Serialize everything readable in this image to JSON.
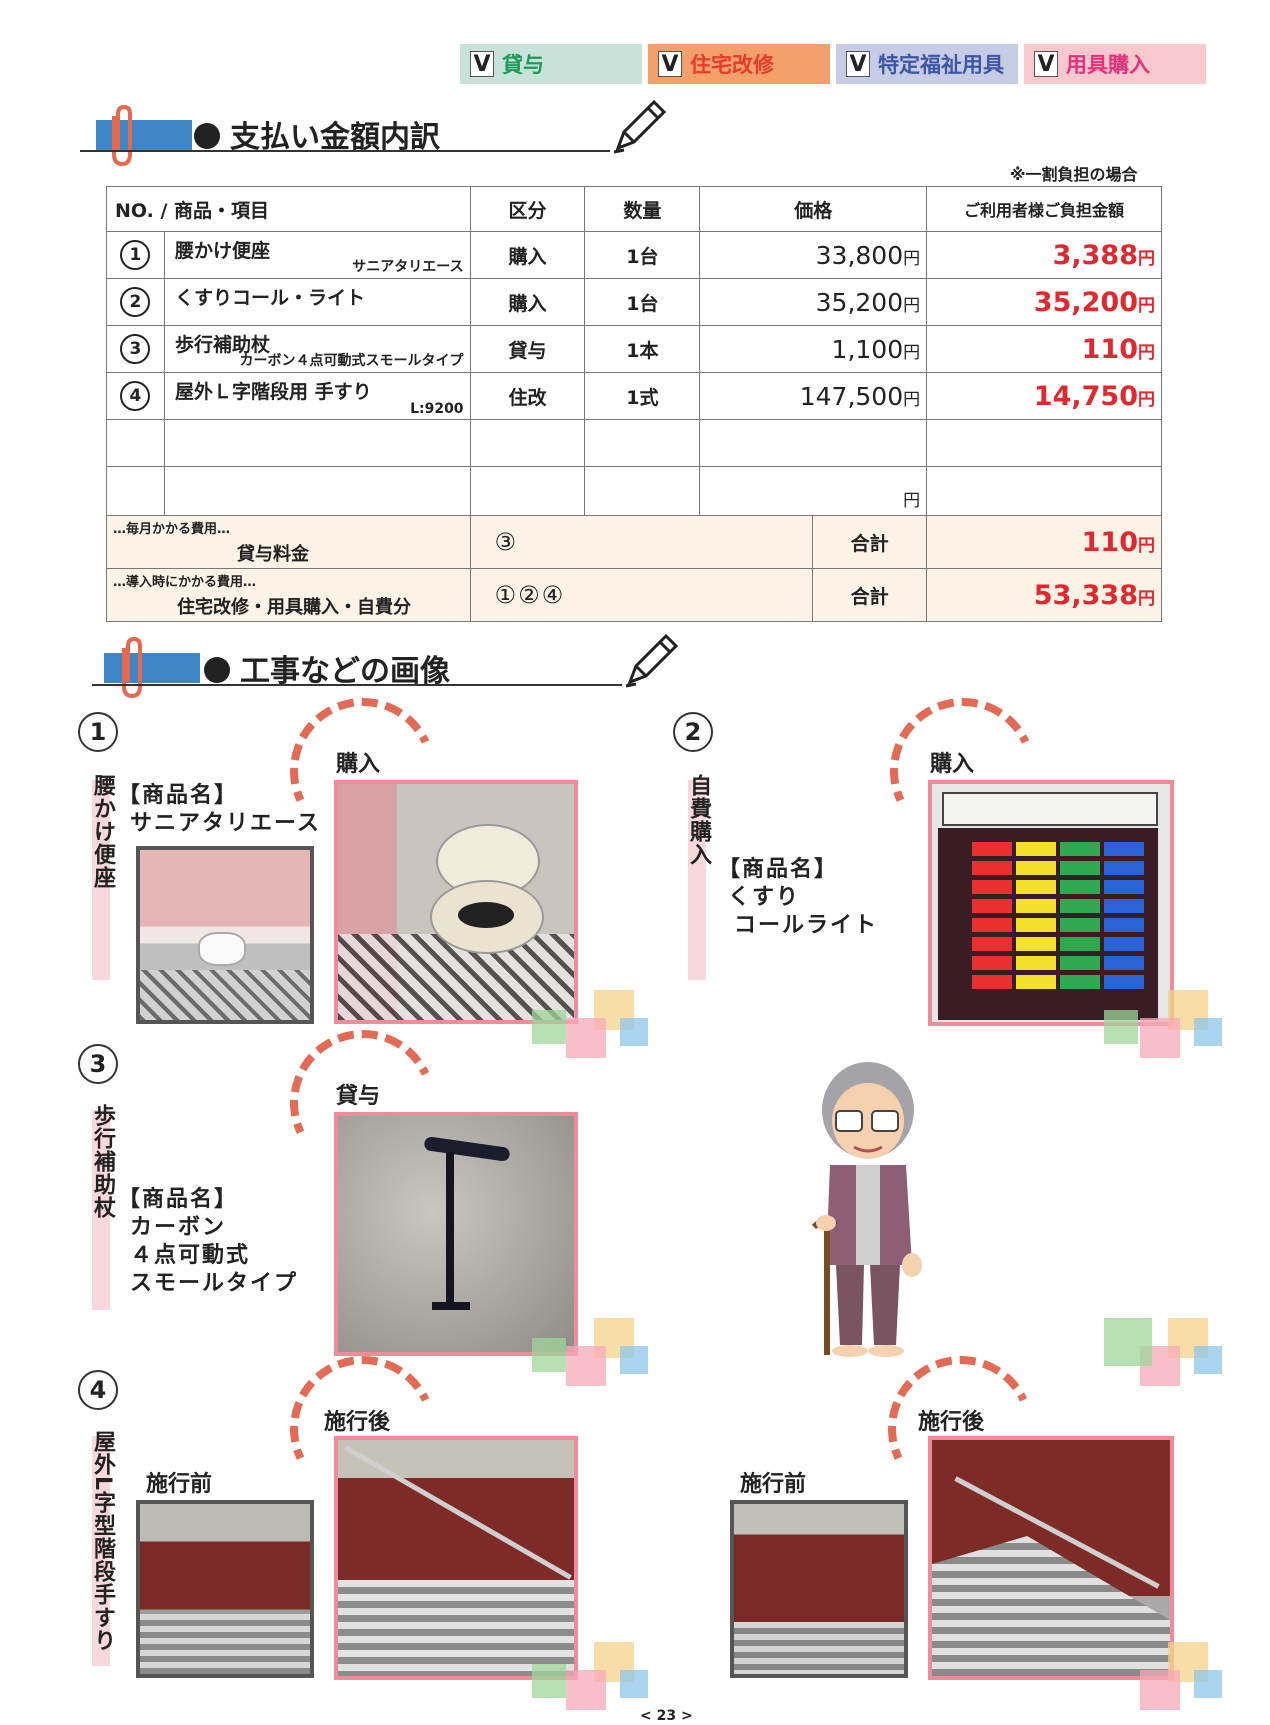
{
  "tags": [
    {
      "label": "貸与",
      "bg": "#c6e2d9",
      "fg": "#1f9a55"
    },
    {
      "label": "住宅改修",
      "bg": "#f4a06d",
      "fg": "#e83b2a"
    },
    {
      "label": "特定福祉用具",
      "bg": "#c6cbe6",
      "fg": "#3d57a3"
    },
    {
      "label": "用具購入",
      "bg": "#f9c8cd",
      "fg": "#e8307a"
    }
  ],
  "check_mark": "V",
  "section1": {
    "title": "支払い金額内訳",
    "note": "※一割負担の場合"
  },
  "table": {
    "headers": [
      "NO. / 商品・項目",
      "区分",
      "数量",
      "価格",
      "ご利用者様ご負担金額"
    ],
    "rows": [
      {
        "no": "1",
        "name": "腰かけ便座",
        "sub": "サニアタリエース",
        "kind": "購入",
        "qty": "1台",
        "price": "33,800",
        "pay": "3,388"
      },
      {
        "no": "2",
        "name": "くすりコール・ライト",
        "sub": "",
        "kind": "購入",
        "qty": "1台",
        "price": "35,200",
        "pay": "35,200"
      },
      {
        "no": "3",
        "name": "歩行補助杖",
        "sub": "カーボン４点可動式スモールタイプ",
        "kind": "貸与",
        "qty": "1本",
        "price": "1,100",
        "pay": "110"
      },
      {
        "no": "4",
        "name": "屋外Ｌ字階段用 手すり",
        "sub": "L:9200",
        "kind": "住改",
        "qty": "1式",
        "price": "147,500",
        "pay": "14,750"
      }
    ],
    "yen": "円",
    "monthly": {
      "caption": "…毎月かかる費用…",
      "label": "貸与料金",
      "items": "③",
      "total_label": "合計",
      "total": "110"
    },
    "initial": {
      "caption": "…導入時にかかる費用…",
      "label": "住宅改修・用具購入・自費分",
      "items": "①②④",
      "total_label": "合計",
      "total": "53,338"
    }
  },
  "section2": {
    "title": "工事などの画像"
  },
  "items": {
    "i1": {
      "num": "1",
      "vertical": "腰かけ便座",
      "product_heading": "【商品名】",
      "product_lines": [
        "サニアタリエース"
      ],
      "badge": "購入"
    },
    "i2": {
      "num": "2",
      "vertical": "自費購入",
      "product_heading": "【商品名】",
      "product_lines": [
        "くすり",
        "コールライト"
      ],
      "badge": "購入"
    },
    "i3": {
      "num": "3",
      "vertical": "歩行補助杖",
      "product_heading": "【商品名】",
      "product_lines": [
        "カーボン",
        "４点可動式",
        "スモールタイプ"
      ],
      "badge": "貸与"
    },
    "i4": {
      "num": "4",
      "vertical": "屋外L字型階段手すり",
      "before": "施行前",
      "after": "施行後"
    }
  },
  "page_number": "< 23 >"
}
